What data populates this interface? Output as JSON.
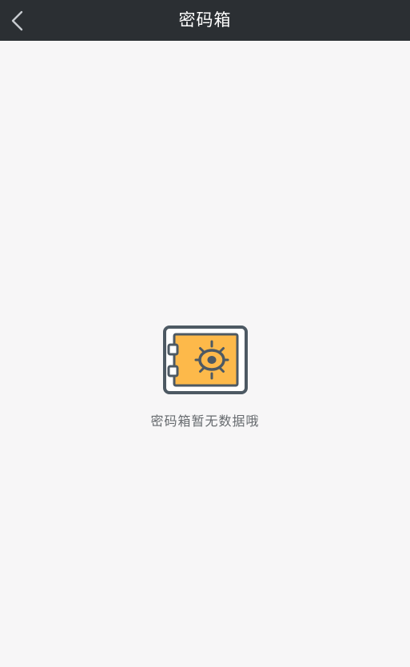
{
  "header": {
    "title": "密码箱",
    "back_icon": "chevron-left-icon"
  },
  "empty_state": {
    "icon": "safe-icon",
    "message": "密码箱暂无数据哦"
  },
  "colors": {
    "nav_background": "#2b2f33",
    "page_background": "#f7f6f7",
    "safe_fill": "#fdb94a",
    "safe_stroke": "#4d5963",
    "text_gray": "#666a6e"
  }
}
